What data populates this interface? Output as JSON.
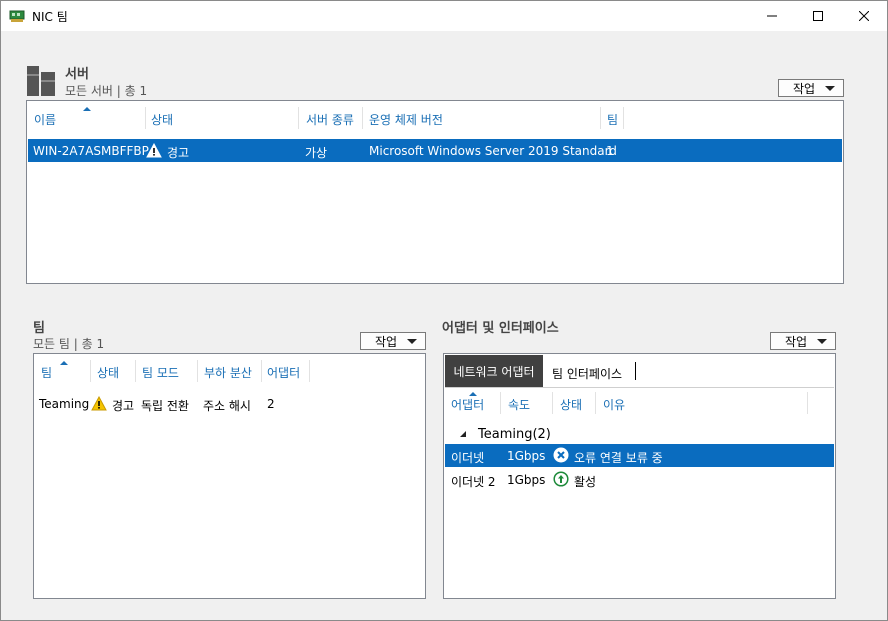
{
  "window": {
    "title": "NIC 팀"
  },
  "servers": {
    "title": "서버",
    "subtitle": "모든 서버 | 총 1",
    "task_label": "작업",
    "columns": [
      "이름",
      "상태",
      "서버 종류",
      "운영 체제 버전",
      "팀"
    ],
    "rows": [
      {
        "name": "WIN-2A7ASMBFFBP",
        "status": "경고",
        "type": "가상",
        "os": "Microsoft Windows Server 2019 Standard",
        "teams": "1"
      }
    ]
  },
  "teams": {
    "title": "팀",
    "subtitle": "모든 팀 | 총 1",
    "task_label": "작업",
    "columns": [
      "팀",
      "상태",
      "팀 모드",
      "부하 분산",
      "어댑터"
    ],
    "rows": [
      {
        "team": "Teaming",
        "status": "경고",
        "mode": "독립 전환",
        "balancing": "주소 해시",
        "adapters": "2"
      }
    ]
  },
  "adapters": {
    "title": "어댑터 및 인터페이스",
    "task_label": "작업",
    "tabs": [
      "네트워크 어댑터",
      "팀 인터페이스"
    ],
    "columns": [
      "어댑터",
      "속도",
      "상태",
      "이유"
    ],
    "group": "Teaming(2)",
    "rows": [
      {
        "adapter": "이더넷",
        "speed": "1Gbps",
        "status": "오류 연결 보류 중"
      },
      {
        "adapter": "이더넷 2",
        "speed": "1Gbps",
        "status": "활성"
      }
    ]
  },
  "colors": {
    "selection": "#0a6cbf",
    "header_text": "#1a6fb5",
    "warning": "#f5c400",
    "active_green": "#1e8a3a"
  }
}
